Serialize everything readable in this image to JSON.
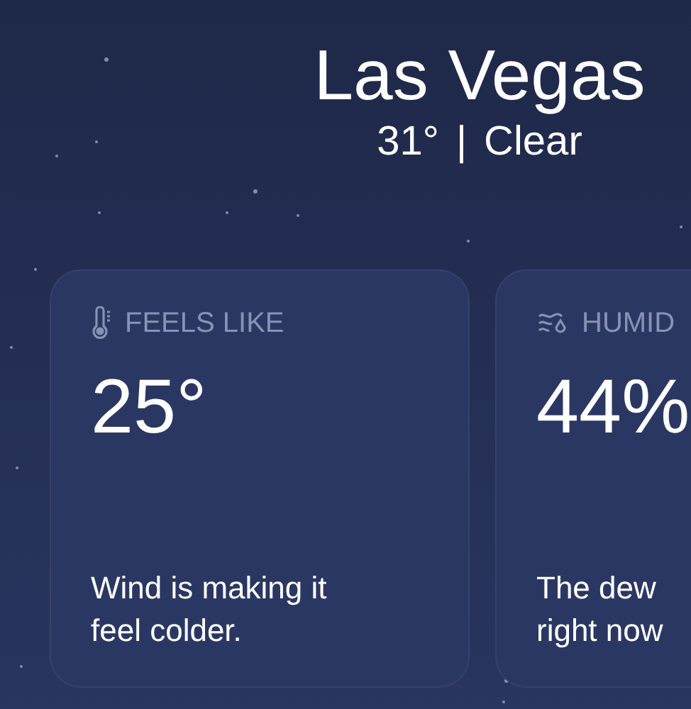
{
  "location": {
    "city": "Las Vegas",
    "temperature": "31°",
    "separator": "|",
    "condition": "Clear"
  },
  "cards": [
    {
      "kind": "thermometer",
      "label": "FEELS LIKE",
      "value": "25°",
      "description": "Wind is making it\nfeel colder."
    },
    {
      "kind": "humidity",
      "label": "HUMID",
      "value": "44%",
      "description": "The dew\nright now"
    }
  ]
}
